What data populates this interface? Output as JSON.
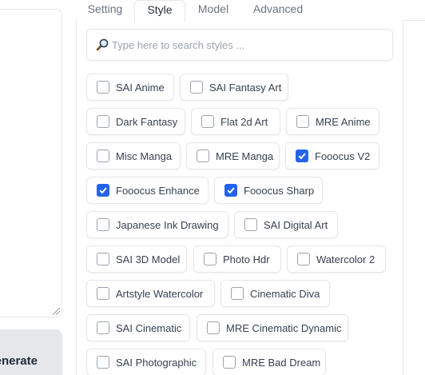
{
  "left": {
    "generate_label": "Generate"
  },
  "tabs": [
    {
      "label": "Setting",
      "active": false
    },
    {
      "label": "Style",
      "active": true
    },
    {
      "label": "Model",
      "active": false
    },
    {
      "label": "Advanced",
      "active": false
    }
  ],
  "search": {
    "placeholder": "Type here to search styles ..."
  },
  "styles": [
    {
      "label": "SAI Anime",
      "checked": false
    },
    {
      "label": "SAI Fantasy Art",
      "checked": false
    },
    {
      "label": "Dark Fantasy",
      "checked": false
    },
    {
      "label": "Flat 2d Art",
      "checked": false
    },
    {
      "label": "MRE Anime",
      "checked": false
    },
    {
      "label": "Misc Manga",
      "checked": false
    },
    {
      "label": "MRE Manga",
      "checked": false
    },
    {
      "label": "Fooocus V2",
      "checked": true
    },
    {
      "label": "Fooocus Enhance",
      "checked": true
    },
    {
      "label": "Fooocus Sharp",
      "checked": true
    },
    {
      "label": "Japanese Ink Drawing",
      "checked": false
    },
    {
      "label": "SAI Digital Art",
      "checked": false
    },
    {
      "label": "SAI 3D Model",
      "checked": false
    },
    {
      "label": "Photo Hdr",
      "checked": false
    },
    {
      "label": "Watercolor 2",
      "checked": false
    },
    {
      "label": "Artstyle Watercolor",
      "checked": false
    },
    {
      "label": "Cinematic Diva",
      "checked": false
    },
    {
      "label": "SAI Cinematic",
      "checked": false
    },
    {
      "label": "MRE Cinematic Dynamic",
      "checked": false
    },
    {
      "label": "SAI Photographic",
      "checked": false
    },
    {
      "label": "MRE Bad Dream",
      "checked": false
    }
  ],
  "colors": {
    "accent": "#2563eb",
    "border": "#e5e7eb"
  }
}
